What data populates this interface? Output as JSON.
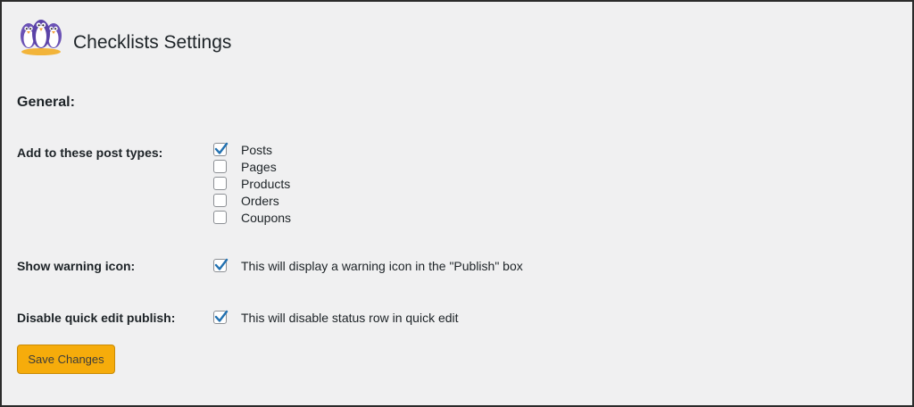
{
  "header": {
    "title": "Checklists Settings",
    "logo_icon": "penguins-logo-icon"
  },
  "section": {
    "title": "General:"
  },
  "post_types": {
    "label": "Add to these post types:",
    "options": [
      {
        "label": "Posts",
        "checked": true
      },
      {
        "label": "Pages",
        "checked": false
      },
      {
        "label": "Products",
        "checked": false
      },
      {
        "label": "Orders",
        "checked": false
      },
      {
        "label": "Coupons",
        "checked": false
      }
    ]
  },
  "warning_icon": {
    "label": "Show warning icon:",
    "description": "This will display a warning icon in the \"Publish\" box",
    "checked": true
  },
  "quick_edit": {
    "label": "Disable quick edit publish:",
    "description": "This will disable status row in quick edit",
    "checked": true
  },
  "save_button": {
    "label": "Save Changes"
  },
  "colors": {
    "background": "#f0f0f1",
    "checkmark": "#2271b1",
    "button": "#f6ac0b"
  }
}
